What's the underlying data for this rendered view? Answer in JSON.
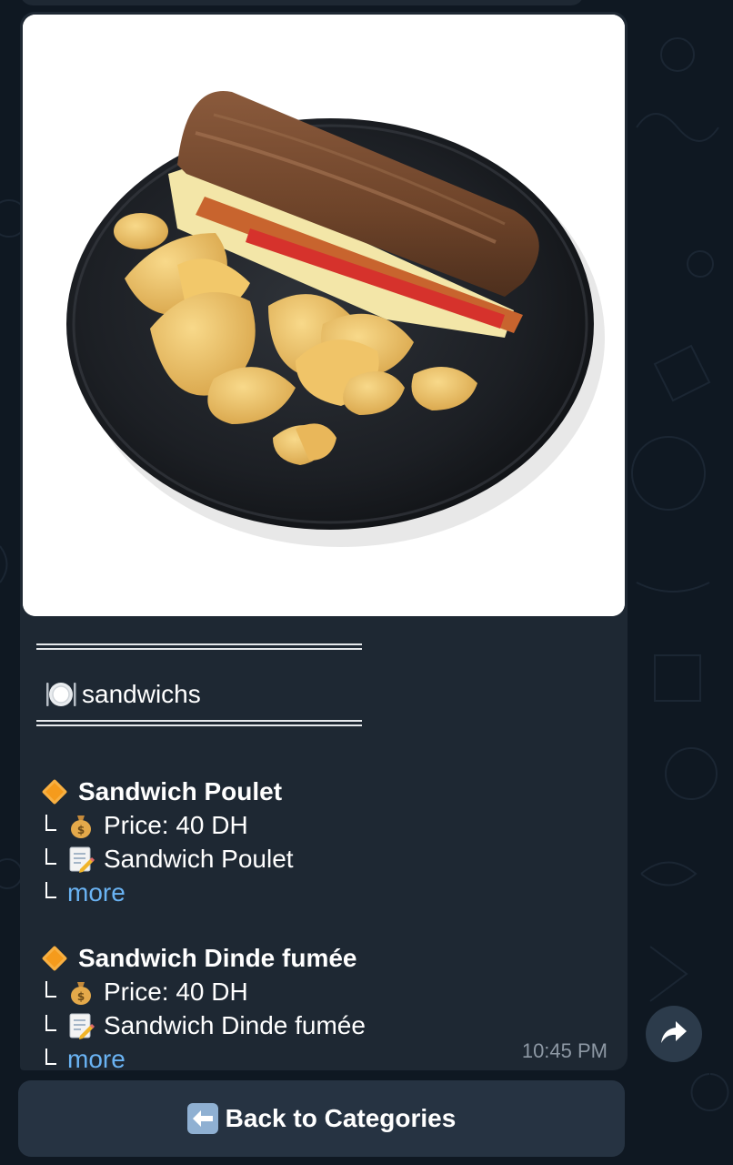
{
  "message": {
    "category": {
      "icon": "plate-fork-knife-icon",
      "label": "sandwichs"
    },
    "items": [
      {
        "icon": "orange-diamond-icon",
        "title": "Sandwich Poulet",
        "price_icon": "money-bag-icon",
        "price": "Price: 40   DH",
        "description_icon": "memo-icon",
        "description": "Sandwich Poulet",
        "more_label": "more"
      },
      {
        "icon": "orange-diamond-icon",
        "title": "Sandwich Dinde fumée",
        "price_icon": "money-bag-icon",
        "price": "Price: 40   DH",
        "description_icon": "memo-icon",
        "description": "Sandwich Dinde fumée",
        "more_label": "more"
      }
    ],
    "time": "10:45 PM"
  },
  "keyboard": {
    "back_icon": "left-arrow-icon",
    "back_label": "Back to Categories"
  },
  "colors": {
    "background": "#0f1822",
    "bubble": "#1e2833",
    "link": "#6ab3f3",
    "timestamp": "#8d98a4",
    "keyboard_button": "#263342",
    "diamond": "#f59b1c"
  }
}
